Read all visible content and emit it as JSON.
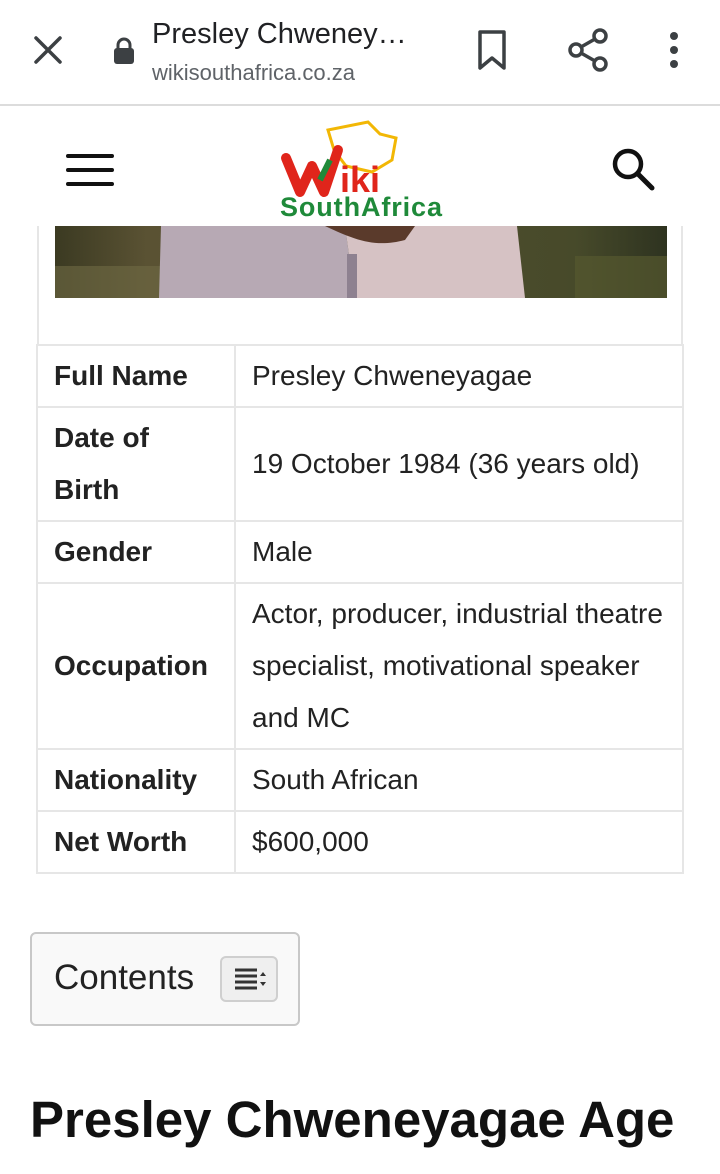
{
  "browser": {
    "title": "Presley Chweney…",
    "url": "wikisouthafrica.co.za"
  },
  "site": {
    "logo_letters": "Wiki",
    "logo_subtitle": "SouthAfrica"
  },
  "infobox": {
    "rows": [
      {
        "key": "Full Name",
        "value": "Presley Chweneyagae"
      },
      {
        "key": "Date of Birth",
        "value": "19 October 1984 (36 years old)"
      },
      {
        "key": "Gender",
        "value": "Male"
      },
      {
        "key": "Occupation",
        "value": "Actor, producer, industrial theatre specialist, motivational speaker and MC"
      },
      {
        "key": "Nationality",
        "value": "South African"
      },
      {
        "key": "Net Worth",
        "value": "$600,000"
      }
    ]
  },
  "toc": {
    "label": "Contents"
  },
  "article": {
    "heading": "Presley Chweneyagae Age"
  },
  "colors": {
    "logo_green": "#1f8a3a",
    "logo_red": "#e0251b",
    "logo_yellow": "#f2b705"
  }
}
